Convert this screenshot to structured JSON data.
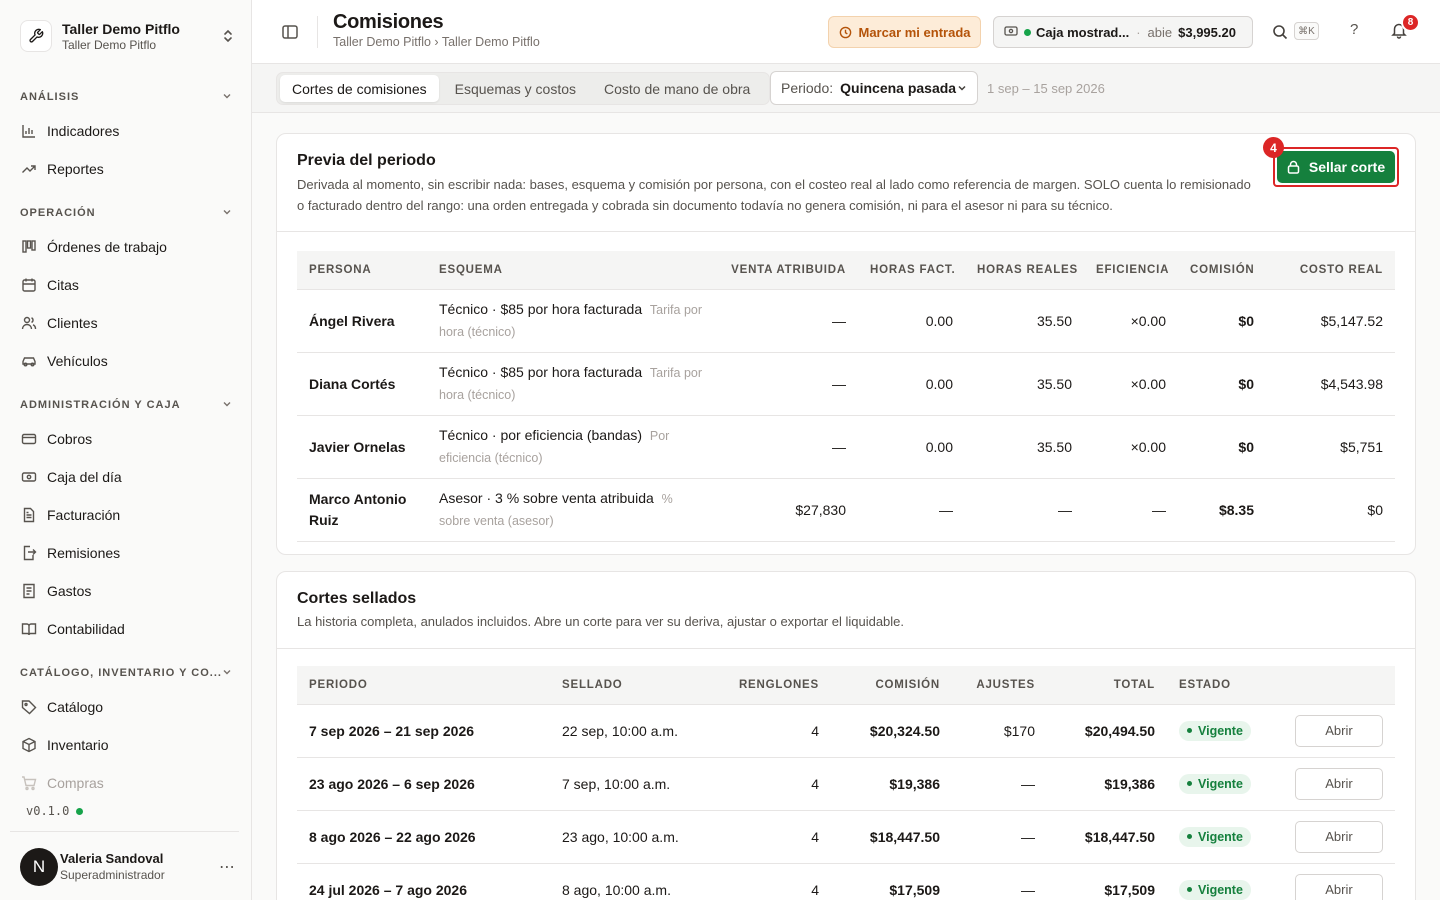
{
  "org": {
    "name": "Taller Demo Pitflo",
    "subtitle": "Taller Demo Pitflo"
  },
  "sidebar": {
    "sections": [
      {
        "title": "ANÁLISIS"
      },
      {
        "title": "OPERACIÓN"
      },
      {
        "title": "ADMINISTRACIÓN Y CAJA"
      },
      {
        "title": "CATÁLOGO, INVENTARIO Y CO..."
      }
    ],
    "items": [
      {
        "label": "Indicadores",
        "icon": "bar-chart-icon"
      },
      {
        "label": "Reportes",
        "icon": "trending-up-icon"
      },
      {
        "label": "Órdenes de trabajo",
        "icon": "kanban-icon"
      },
      {
        "label": "Citas",
        "icon": "calendar-icon"
      },
      {
        "label": "Clientes",
        "icon": "users-icon"
      },
      {
        "label": "Vehículos",
        "icon": "car-icon"
      },
      {
        "label": "Cobros",
        "icon": "credit-card-icon"
      },
      {
        "label": "Caja del día",
        "icon": "cash-register-icon"
      },
      {
        "label": "Facturación",
        "icon": "file-text-icon"
      },
      {
        "label": "Remisiones",
        "icon": "file-export-icon"
      },
      {
        "label": "Gastos",
        "icon": "receipt-icon"
      },
      {
        "label": "Contabilidad",
        "icon": "book-icon"
      },
      {
        "label": "Catálogo",
        "icon": "tag-icon"
      },
      {
        "label": "Inventario",
        "icon": "package-icon"
      },
      {
        "label": "Compras",
        "icon": "shopping-cart-icon"
      }
    ],
    "version": "v0.1.0",
    "user": {
      "initial": "N",
      "name": "Valeria Sandoval",
      "role": "Superadministrador"
    }
  },
  "header": {
    "title": "Comisiones",
    "breadcrumb": "Taller Demo Pitflo › Taller Demo Pitflo",
    "checkin_label": "Marcar mi entrada",
    "cash": {
      "name": "Caja mostrad...",
      "separator": "·",
      "status": "abie",
      "amount": "$3,995.20"
    },
    "kbd": "⌘K",
    "help": "?",
    "notifications": "8"
  },
  "subnav": {
    "tabs": [
      "Cortes de comisiones",
      "Esquemas y costos",
      "Costo de mano de obra"
    ],
    "period_label": "Periodo:",
    "period_value": "Quincena pasada",
    "period_range": "1 sep – 15 sep 2026"
  },
  "preview": {
    "title": "Previa del periodo",
    "description": "Derivada al momento, sin escribir nada: bases, esquema y comisión por persona, con el costeo real al lado como referencia de margen. SOLO cuenta lo remisionado o facturado dentro del rango: una orden entregada y cobrada sin documento todavía no genera comisión, ni para el asesor ni para su técnico.",
    "seal_label": "Sellar corte",
    "step": "4",
    "columns": [
      "PERSONA",
      "ESQUEMA",
      "VENTA ATRIBUIDA",
      "HORAS FACT.",
      "HORAS REALES",
      "EFICIENCIA",
      "COMISIÓN",
      "COSTO REAL"
    ],
    "rows": [
      {
        "person": "Ángel Rivera",
        "scheme": "Técnico · $85 por hora facturada",
        "note": "Tarifa por hora (técnico)",
        "sales": "—",
        "billed": "0.00",
        "real": "35.50",
        "eff": "×0.00",
        "comm": "$0",
        "cost": "$5,147.52"
      },
      {
        "person": "Diana Cortés",
        "scheme": "Técnico · $85 por hora facturada",
        "note": "Tarifa por hora (técnico)",
        "sales": "—",
        "billed": "0.00",
        "real": "35.50",
        "eff": "×0.00",
        "comm": "$0",
        "cost": "$4,543.98"
      },
      {
        "person": "Javier Ornelas",
        "scheme": "Técnico · por eficiencia (bandas)",
        "note": "Por eficiencia (técnico)",
        "sales": "—",
        "billed": "0.00",
        "real": "35.50",
        "eff": "×0.00",
        "comm": "$0",
        "cost": "$5,751"
      },
      {
        "person": "Marco Antonio Ruiz",
        "scheme": "Asesor · 3 % sobre venta atribuida",
        "note": "% sobre venta (asesor)",
        "sales": "$27,830",
        "billed": "—",
        "real": "—",
        "eff": "—",
        "comm": "$8.35",
        "cost": "$0"
      }
    ]
  },
  "sealed": {
    "title": "Cortes sellados",
    "description": "La historia completa, anulados incluidos. Abre un corte para ver su deriva, ajustar o exportar el liquidable.",
    "columns": [
      "PERIODO",
      "SELLADO",
      "RENGLONES",
      "COMISIÓN",
      "AJUSTES",
      "TOTAL",
      "ESTADO",
      ""
    ],
    "open_label": "Abrir",
    "rows": [
      {
        "period": "7 sep 2026 – 21 sep 2026",
        "sealed": "22 sep, 10:00 a.m.",
        "lines": "4",
        "comm": "$20,324.50",
        "adj": "$170",
        "total": "$20,494.50",
        "status": "Vigente"
      },
      {
        "period": "23 ago 2026 – 6 sep 2026",
        "sealed": "7 sep, 10:00 a.m.",
        "lines": "4",
        "comm": "$19,386",
        "adj": "—",
        "total": "$19,386",
        "status": "Vigente"
      },
      {
        "period": "8 ago 2026 – 22 ago 2026",
        "sealed": "23 ago, 10:00 a.m.",
        "lines": "4",
        "comm": "$18,447.50",
        "adj": "—",
        "total": "$18,447.50",
        "status": "Vigente"
      },
      {
        "period": "24 jul 2026 – 7 ago 2026",
        "sealed": "8 ago, 10:00 a.m.",
        "lines": "4",
        "comm": "$17,509",
        "adj": "—",
        "total": "$17,509",
        "status": "Vigente"
      }
    ]
  },
  "colors": {
    "accent_green": "#15803d",
    "danger": "#dc2626",
    "warning_bg": "#fdecd8",
    "warning_text": "#b45309"
  }
}
